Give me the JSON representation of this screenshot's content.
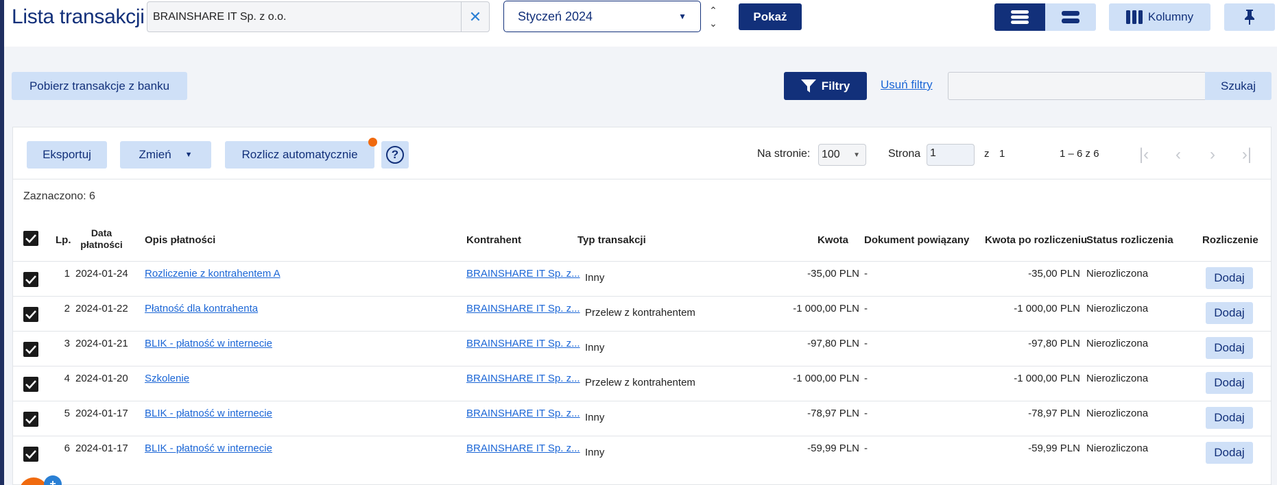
{
  "header": {
    "title": "Lista transakcji",
    "company_value": "BRAINSHARE IT Sp. z o.o.",
    "month_value": "Styczeń 2024",
    "show_label": "Pokaż",
    "columns_label": "Kolumny"
  },
  "actions": {
    "fetch_label": "Pobierz transakcje z banku",
    "filters_label": "Filtry",
    "clear_filters_label": "Usuń filtry",
    "search_placeholder": "",
    "search_button_label": "Szukaj"
  },
  "toolbar": {
    "export_label": "Eksportuj",
    "change_label": "Zmień",
    "auto_settle_label": "Rozlicz automatycznie",
    "per_page_label": "Na stronie:",
    "per_page_value": "100",
    "page_label": "Strona",
    "page_value": "1",
    "of_label": "z",
    "total_pages": "1",
    "range_label": "1 – 6 z 6"
  },
  "selected_label": "Zaznaczono: 6",
  "table": {
    "headers": {
      "lp": "Lp.",
      "date_line1": "Data",
      "date_line2": "płatności",
      "description": "Opis płatności",
      "contractor": "Kontrahent",
      "type": "Typ transakcji",
      "amount": "Kwota",
      "document": "Dokument powiązany",
      "amount_after": "Kwota po rozliczeniu",
      "status": "Status rozliczenia",
      "settlement": "Rozliczenie"
    },
    "rows": [
      {
        "lp": "1",
        "date": "2024-01-24",
        "description": "Rozliczenie z kontrahentem A",
        "contractor": "BRAINSHARE IT Sp. z...",
        "type": "Inny",
        "amount": "-35,00 PLN",
        "document": "-",
        "amount_after": "-35,00 PLN",
        "status": "Nierozliczona",
        "action": "Dodaj"
      },
      {
        "lp": "2",
        "date": "2024-01-22",
        "description": "Płatność dla kontrahenta",
        "contractor": "BRAINSHARE IT Sp. z...",
        "type": "Przelew z kontrahentem",
        "amount": "-1 000,00 PLN",
        "document": "-",
        "amount_after": "-1 000,00 PLN",
        "status": "Nierozliczona",
        "action": "Dodaj"
      },
      {
        "lp": "3",
        "date": "2024-01-21",
        "description": "BLIK - płatność w internecie",
        "contractor": "BRAINSHARE IT Sp. z...",
        "type": "Inny",
        "amount": "-97,80 PLN",
        "document": "-",
        "amount_after": "-97,80 PLN",
        "status": "Nierozliczona",
        "action": "Dodaj"
      },
      {
        "lp": "4",
        "date": "2024-01-20",
        "description": "Szkolenie",
        "contractor": "BRAINSHARE IT Sp. z...",
        "type": "Przelew z kontrahentem",
        "amount": "-1 000,00 PLN",
        "document": "-",
        "amount_after": "-1 000,00 PLN",
        "status": "Nierozliczona",
        "action": "Dodaj"
      },
      {
        "lp": "5",
        "date": "2024-01-17",
        "description": "BLIK - płatność w internecie",
        "contractor": "BRAINSHARE IT Sp. z...",
        "type": "Inny",
        "amount": "-78,97 PLN",
        "document": "-",
        "amount_after": "-78,97 PLN",
        "status": "Nierozliczona",
        "action": "Dodaj"
      },
      {
        "lp": "6",
        "date": "2024-01-17",
        "description": "BLIK - płatność w internecie",
        "contractor": "BRAINSHARE IT Sp. z...",
        "type": "Inny",
        "amount": "-59,99 PLN",
        "document": "-",
        "amount_after": "-59,99 PLN",
        "status": "Nierozliczona",
        "action": "Dodaj"
      }
    ]
  },
  "colors": {
    "primary": "#12307a",
    "light_button": "#cfe0f7",
    "link": "#1b66d6",
    "notification": "#f06a0f"
  },
  "icons": [
    "close-icon",
    "chevron-down-icon",
    "arrow-up-icon",
    "arrow-down-icon",
    "list-view-icon",
    "compact-view-icon",
    "columns-icon",
    "pin-icon",
    "filter-icon",
    "help-icon",
    "first-page-icon",
    "prev-page-icon",
    "next-page-icon",
    "last-page-icon",
    "checkbox-checked-icon"
  ]
}
